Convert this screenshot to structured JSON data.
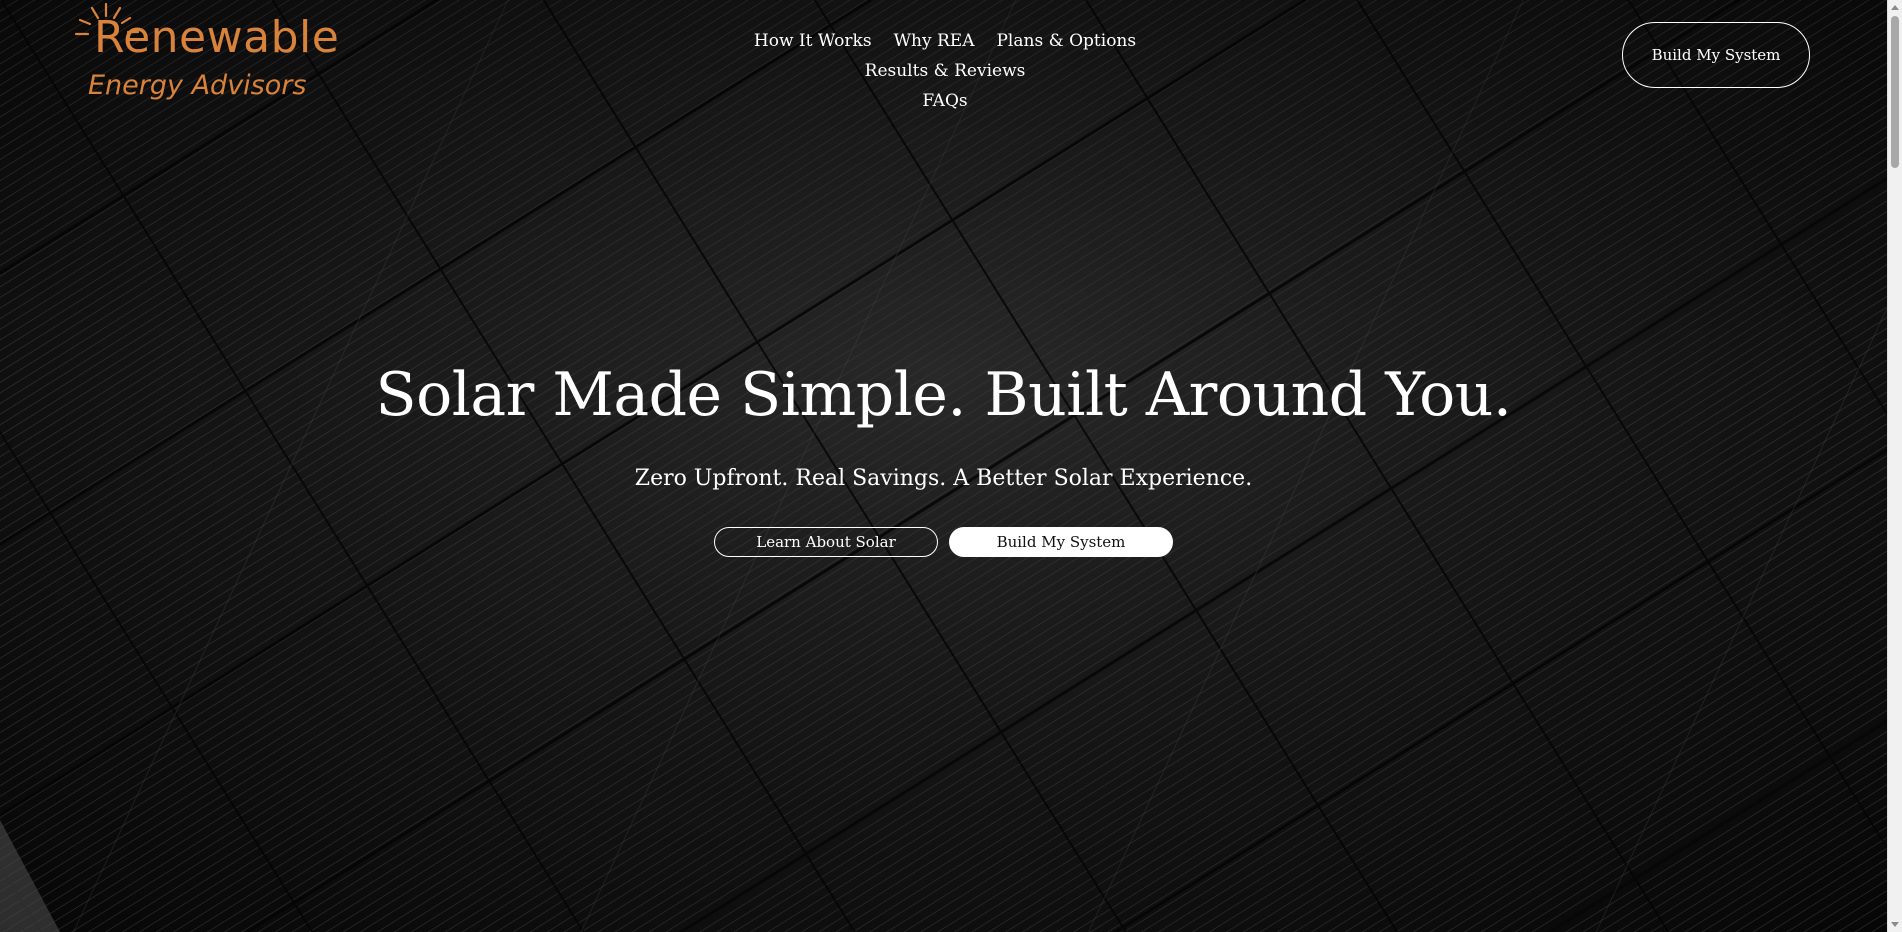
{
  "logo": {
    "line1": "Renewable",
    "line2": "Energy Advisors",
    "color": "#d9823a"
  },
  "nav": {
    "items": [
      {
        "label": "How It Works"
      },
      {
        "label": "Why REA"
      },
      {
        "label": "Plans & Options"
      },
      {
        "label": "Results & Reviews"
      },
      {
        "label": "FAQs"
      }
    ]
  },
  "header": {
    "cta_label": "Build My System"
  },
  "hero": {
    "title": "Solar Made Simple. Built Around You.",
    "subtitle": "Zero Upfront. Real Savings. A Better Solar Experience.",
    "primary_button": "Learn About Solar",
    "secondary_button": "Build My System"
  },
  "colors": {
    "background": "#0b0b0b",
    "text": "#ffffff",
    "accent": "#d9823a"
  }
}
